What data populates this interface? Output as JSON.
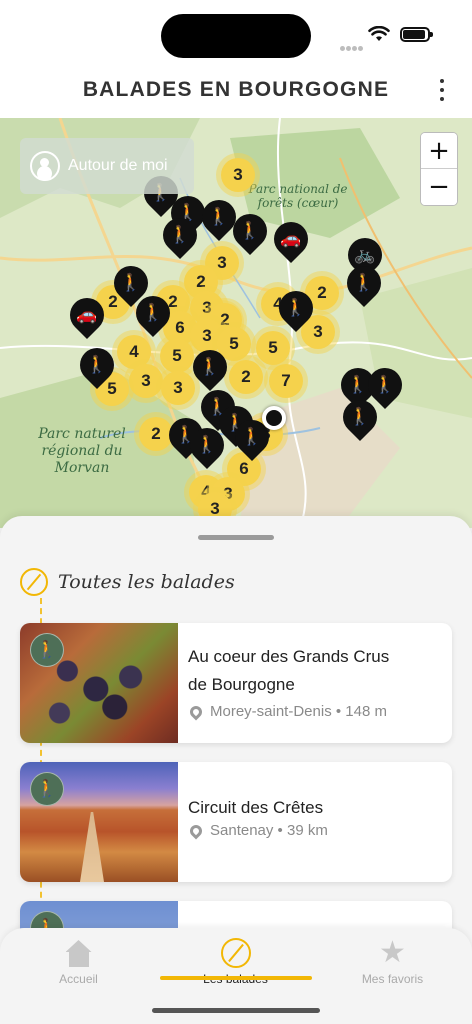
{
  "header": {
    "title": "BALADES EN BOURGOGNE",
    "menu_icon": "more-vertical-icon"
  },
  "map": {
    "around_me_label": "Autour de moi",
    "zoom_in_label": "+",
    "zoom_out_label": "−",
    "labels": {
      "parc_national": "Parc national de forêts (cœur)",
      "parc_morvan": "Parc naturel régional du Morvan"
    },
    "clusters": [
      {
        "count": "3"
      },
      {
        "count": "3"
      },
      {
        "count": "2"
      },
      {
        "count": "3"
      },
      {
        "count": "2"
      },
      {
        "count": "2"
      },
      {
        "count": "3"
      },
      {
        "count": "6"
      },
      {
        "count": "2"
      },
      {
        "count": "4"
      },
      {
        "count": "2"
      },
      {
        "count": "3"
      },
      {
        "count": "3"
      },
      {
        "count": "5"
      },
      {
        "count": "4"
      },
      {
        "count": "5"
      },
      {
        "count": "3"
      },
      {
        "count": "3"
      },
      {
        "count": "2"
      },
      {
        "count": "7"
      },
      {
        "count": "5"
      },
      {
        "count": "2"
      },
      {
        "count": "5"
      },
      {
        "count": "6"
      },
      {
        "count": "4"
      },
      {
        "count": "3"
      },
      {
        "count": "3"
      },
      {
        "count": "3"
      }
    ],
    "pins": [
      {
        "type": "walk"
      },
      {
        "type": "walk"
      },
      {
        "type": "walk"
      },
      {
        "type": "walk"
      },
      {
        "type": "walk"
      },
      {
        "type": "car"
      },
      {
        "type": "bike"
      },
      {
        "type": "walk"
      },
      {
        "type": "walk"
      },
      {
        "type": "walk"
      },
      {
        "type": "car"
      },
      {
        "type": "walk"
      },
      {
        "type": "walk"
      },
      {
        "type": "walk"
      },
      {
        "type": "walk"
      },
      {
        "type": "walk"
      },
      {
        "type": "walk"
      },
      {
        "type": "walk"
      },
      {
        "type": "walk"
      },
      {
        "type": "walk"
      },
      {
        "type": "walk"
      },
      {
        "type": "walk"
      }
    ]
  },
  "section": {
    "title": "Toutes les balades"
  },
  "walks": [
    {
      "title_line1": "Au coeur des Grands Crus",
      "title_line2": "de Bourgogne",
      "meta": "Morey-saint-Denis • 148 m"
    },
    {
      "title_line1": "Circuit des Crêtes",
      "title_line2": "",
      "meta": "Santenay • 39 km"
    },
    {
      "title_line1": "",
      "title_line2": "",
      "meta": ""
    }
  ],
  "tabs": [
    {
      "label": "Accueil",
      "icon": "home-icon",
      "active": false
    },
    {
      "label": "Les balades",
      "icon": "balades-icon",
      "active": true
    },
    {
      "label": "Mes favoris",
      "icon": "star-icon",
      "active": false
    }
  ],
  "colors": {
    "accent": "#f2b705",
    "cluster": "#f5d24c",
    "pin": "#111111",
    "badge": "#4e6f57"
  }
}
